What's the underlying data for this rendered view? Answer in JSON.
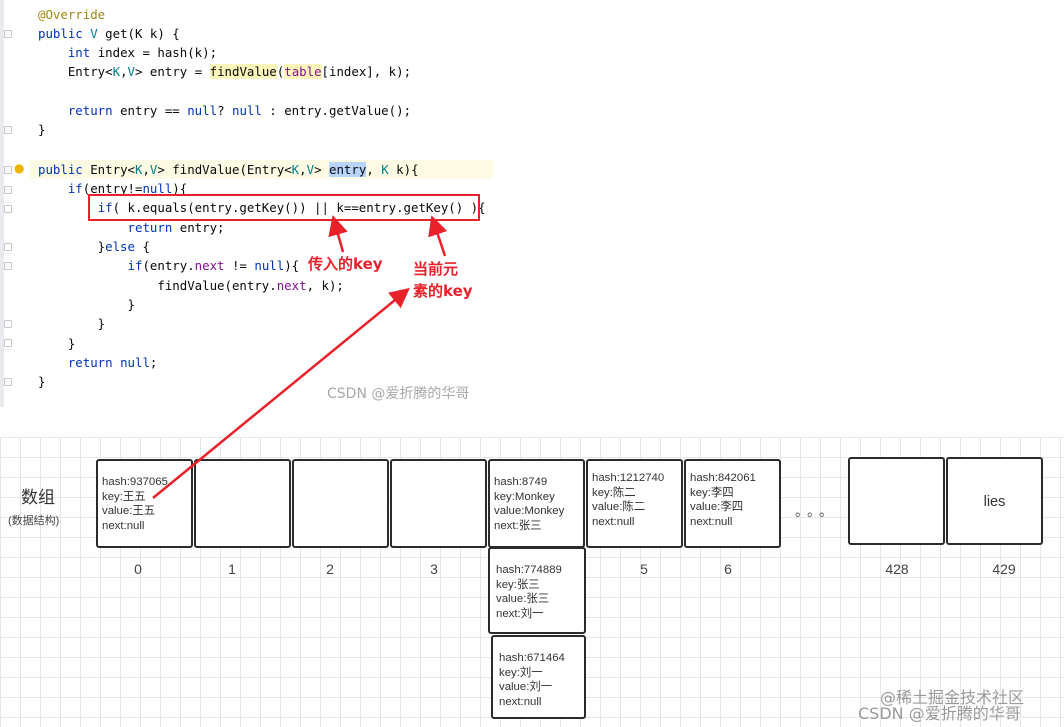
{
  "code": {
    "lines": [
      "@Override",
      "public V get(K k) {",
      "    int index = hash(k);",
      "    Entry<K,V> entry = findValue(table[index], k);",
      "",
      "    return entry == null? null : entry.getValue();",
      "}",
      "",
      "public Entry<K,V> findValue(Entry<K,V> entry, K k){",
      "    if(entry!=null){",
      "        if( k.equals(entry.getKey()) || k==entry.getKey() ){",
      "            return entry;",
      "        }else {",
      "            if(entry.next != null){",
      "                findValue(entry.next, k);",
      "            }",
      "        }",
      "    }",
      "    return null;",
      "}"
    ]
  },
  "annotations": {
    "passed_key": "传入的key",
    "current_key_line1": "当前元",
    "current_key_line2": "素的key"
  },
  "watermarks": {
    "code_watermark": "CSDN @爱折腾的华哥",
    "bottom_watermark_1": "@稀土掘金技术社区",
    "bottom_watermark_2": "CSDN @爱折腾的华哥"
  },
  "array": {
    "title": "数组",
    "subtitle": "(数据结构)",
    "ellipsis": "。。。",
    "slots": [
      {
        "index": "0",
        "lines": [
          "hash:937065",
          "key:王五",
          "value:王五",
          "next:null"
        ]
      },
      {
        "index": "1",
        "lines": []
      },
      {
        "index": "2",
        "lines": []
      },
      {
        "index": "3",
        "lines": []
      },
      {
        "index": "",
        "lines": [
          "hash:8749",
          "key:Monkey",
          "value:Monkey",
          "next:张三"
        ]
      },
      {
        "index": "5",
        "lines": [
          "hash:1212740",
          "key:陈二",
          "value:陈二",
          "next:null"
        ]
      },
      {
        "index": "6",
        "lines": [
          "hash:842061",
          "key:李四",
          "value:李四",
          "next:null"
        ]
      },
      {
        "index": "428",
        "lines": []
      },
      {
        "index": "429",
        "lines": [
          "lies"
        ]
      }
    ],
    "chain": [
      {
        "lines": [
          "hash:774889",
          "key:张三",
          "value:张三",
          "next:刘一"
        ]
      },
      {
        "lines": [
          "hash:671464",
          "key:刘一",
          "value:刘一",
          "next:null"
        ]
      }
    ]
  }
}
